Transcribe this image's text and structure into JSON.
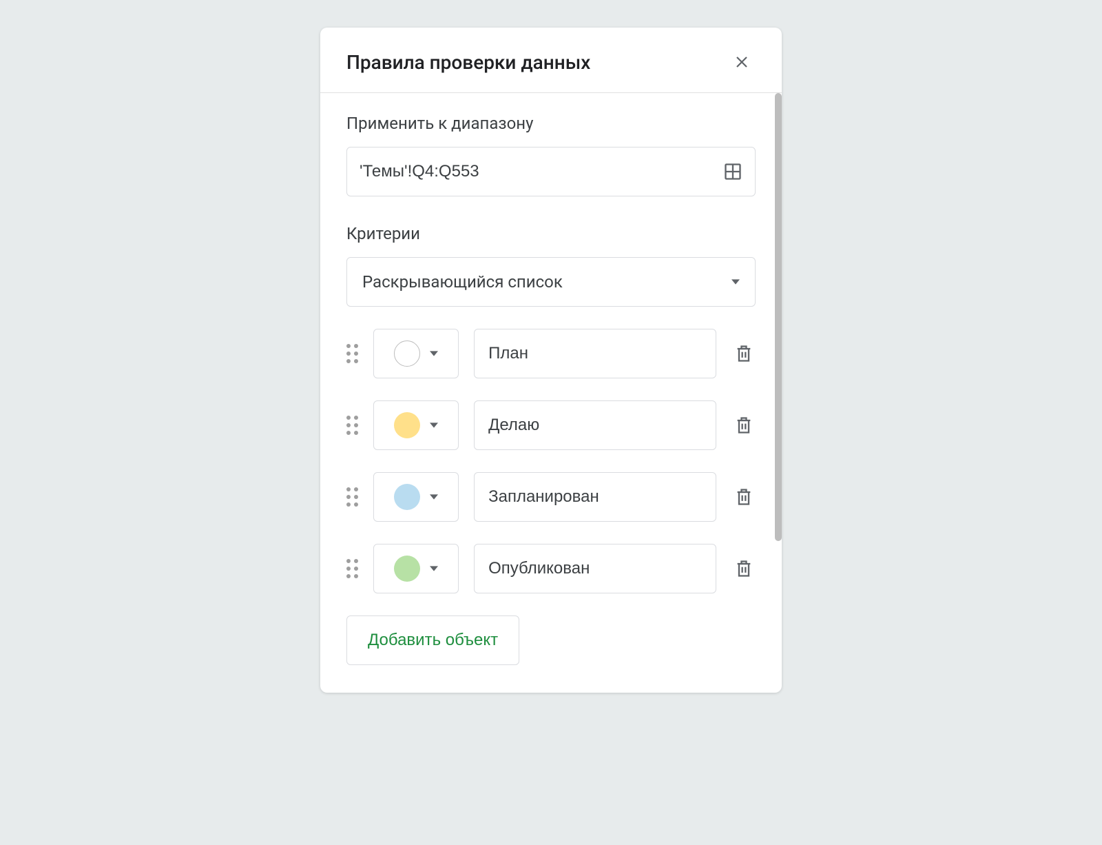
{
  "panel": {
    "title": "Правила проверки данных"
  },
  "range": {
    "label": "Применить к диапазону",
    "value": "'Темы'!Q4:Q553"
  },
  "criteria": {
    "label": "Критерии",
    "selected": "Раскрывающийся список"
  },
  "options": [
    {
      "value": "План",
      "color": "#ffffff",
      "bordered": true
    },
    {
      "value": "Делаю",
      "color": "#ffe08a",
      "bordered": false
    },
    {
      "value": "Запланирован",
      "color": "#b9dcf0",
      "bordered": false
    },
    {
      "value": "Опубликован",
      "color": "#b7e1a5",
      "bordered": false
    }
  ],
  "add_button": {
    "label": "Добавить объект"
  }
}
